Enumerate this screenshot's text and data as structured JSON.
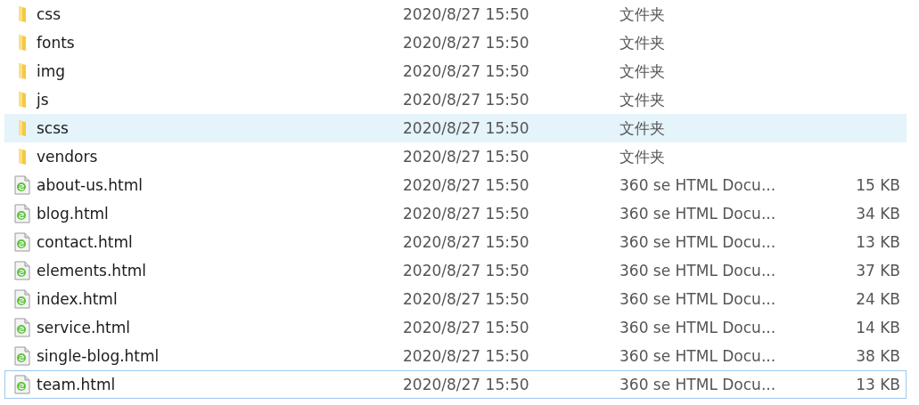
{
  "files": [
    {
      "kind": "folder",
      "name": "css",
      "date": "2020/8/27 15:50",
      "type": "文件夹",
      "hovered": false,
      "focused": false
    },
    {
      "kind": "folder",
      "name": "fonts",
      "date": "2020/8/27 15:50",
      "type": "文件夹",
      "hovered": false,
      "focused": false
    },
    {
      "kind": "folder",
      "name": "img",
      "date": "2020/8/27 15:50",
      "type": "文件夹",
      "hovered": false,
      "focused": false
    },
    {
      "kind": "folder",
      "name": "js",
      "date": "2020/8/27 15:50",
      "type": "文件夹",
      "hovered": false,
      "focused": false
    },
    {
      "kind": "folder",
      "name": "scss",
      "date": "2020/8/27 15:50",
      "type": "文件夹",
      "hovered": true,
      "focused": false
    },
    {
      "kind": "folder",
      "name": "vendors",
      "date": "2020/8/27 15:50",
      "type": "文件夹",
      "hovered": false,
      "focused": false
    },
    {
      "kind": "file",
      "name": "about-us.html",
      "date": "2020/8/27 15:50",
      "type": "360 se HTML Docu...",
      "size": "15 KB",
      "hovered": false,
      "focused": false
    },
    {
      "kind": "file",
      "name": "blog.html",
      "date": "2020/8/27 15:50",
      "type": "360 se HTML Docu...",
      "size": "34 KB",
      "hovered": false,
      "focused": false
    },
    {
      "kind": "file",
      "name": "contact.html",
      "date": "2020/8/27 15:50",
      "type": "360 se HTML Docu...",
      "size": "13 KB",
      "hovered": false,
      "focused": false
    },
    {
      "kind": "file",
      "name": "elements.html",
      "date": "2020/8/27 15:50",
      "type": "360 se HTML Docu...",
      "size": "37 KB",
      "hovered": false,
      "focused": false
    },
    {
      "kind": "file",
      "name": "index.html",
      "date": "2020/8/27 15:50",
      "type": "360 se HTML Docu...",
      "size": "24 KB",
      "hovered": false,
      "focused": false
    },
    {
      "kind": "file",
      "name": "service.html",
      "date": "2020/8/27 15:50",
      "type": "360 se HTML Docu...",
      "size": "14 KB",
      "hovered": false,
      "focused": false
    },
    {
      "kind": "file",
      "name": "single-blog.html",
      "date": "2020/8/27 15:50",
      "type": "360 se HTML Docu...",
      "size": "38 KB",
      "hovered": false,
      "focused": false
    },
    {
      "kind": "file",
      "name": "team.html",
      "date": "2020/8/27 15:50",
      "type": "360 se HTML Docu...",
      "size": "13 KB",
      "hovered": false,
      "focused": true
    }
  ]
}
